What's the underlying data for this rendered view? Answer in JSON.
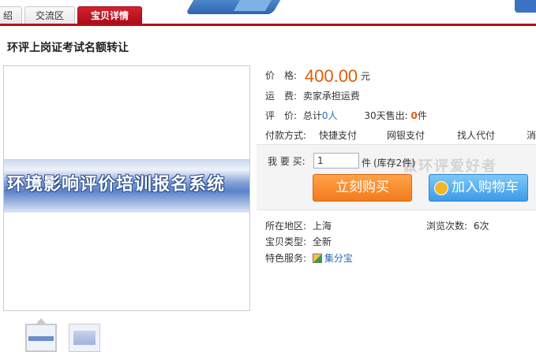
{
  "tabs": [
    {
      "label": "绍"
    },
    {
      "label": "交流区"
    },
    {
      "label": "宝贝详情"
    }
  ],
  "product": {
    "title": "环评上岗证考试名额转让",
    "image_text": "环境影响评价培训报名系统"
  },
  "price": {
    "label": "价　格:",
    "value": "400.00",
    "unit": "元"
  },
  "shipping": {
    "label": "运　费:",
    "value": "卖家承担运费"
  },
  "reviews": {
    "label": "评　价:",
    "total_prefix": "总计",
    "total_value": "0人",
    "sold_label": "30天售出:",
    "sold_value": "0",
    "sold_unit": "件"
  },
  "payment": {
    "label": "付款方式:",
    "methods": [
      "快捷支付",
      "网银支付",
      "找人代付",
      "消"
    ]
  },
  "purchase": {
    "qty_label": "我 要 买:",
    "qty_value": "1",
    "qty_unit": "件",
    "stock": "(库存2件)",
    "buy_label": "立刻购买",
    "cart_label": "加入购物车",
    "watermark": "做环评爱好者"
  },
  "info": {
    "location_label": "所在地区:",
    "location_value": "上海",
    "views_label": "浏览次数:",
    "views_value": "6次",
    "type_label": "宝贝类型:",
    "type_value": "全新",
    "service_label": "特色服务:",
    "service_value": "集分宝"
  },
  "colors": {
    "accent_red": "#b70f1b",
    "price_orange": "#e45c00",
    "link_blue": "#2b67b7"
  }
}
